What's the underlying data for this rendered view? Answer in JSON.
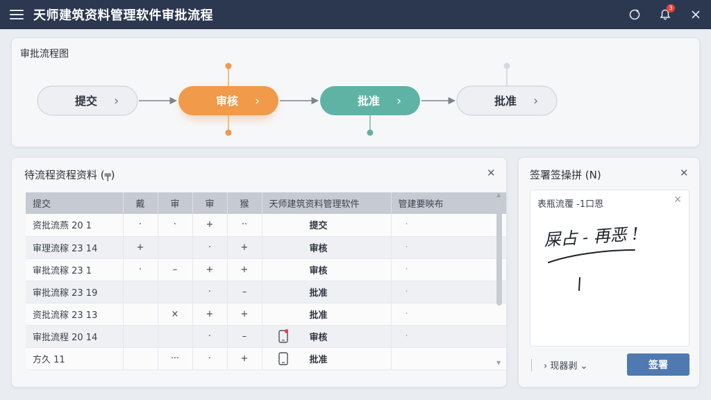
{
  "app": {
    "title": "天师建筑资料管理软件审批流程",
    "notification_count": "3",
    "icons": [
      "menu-icon",
      "refresh-icon",
      "bell-icon",
      "close-icon"
    ]
  },
  "flow": {
    "title": "审批流程图",
    "nodes": [
      {
        "label": "提交",
        "style": "outline",
        "color": "#eeeff2"
      },
      {
        "label": "审核",
        "style": "filled",
        "color": "#f09a4a"
      },
      {
        "label": "批准",
        "style": "filled",
        "color": "#5fb3a4"
      },
      {
        "label": "批准",
        "style": "outline",
        "color": "#eeeff2"
      }
    ],
    "arrow_glyph": "›"
  },
  "documents": {
    "title": "待流程资程资料 (╤)",
    "columns": [
      "提交",
      "戴",
      "审",
      "审",
      "猴",
      "天师建筑资料管理软件",
      "管建要映布"
    ],
    "rows": [
      {
        "name": "资批流燕 20 1",
        "c1": "·",
        "c2": "·",
        "c3": "+",
        "c4": "··",
        "icon": "",
        "stage": "提交",
        "last": "·"
      },
      {
        "name": "审理流稼 23 14",
        "c1": "+",
        "c2": "",
        "c3": "·",
        "c4": "+",
        "icon": "",
        "stage": "审核",
        "last": "·"
      },
      {
        "name": "审批流稼 23 1",
        "c1": "·",
        "c2": "–",
        "c3": "+",
        "c4": "+",
        "icon": "",
        "stage": "审核",
        "last": "·"
      },
      {
        "name": "审批流稼 23 19",
        "c1": "",
        "c2": "",
        "c3": "·",
        "c4": "–",
        "icon": "",
        "stage": "批准",
        "last": "·"
      },
      {
        "name": "资批流稼 23 13",
        "c1": "",
        "c2": "×",
        "c3": "+",
        "c4": "+",
        "icon": "",
        "stage": "批准",
        "last": "·"
      },
      {
        "name": "审批流程 20 14",
        "c1": "",
        "c2": "",
        "c3": "·",
        "c4": "–",
        "icon": "phone-alert-icon",
        "stage": "审核",
        "last": "·"
      },
      {
        "name": "方久           11",
        "c1": "",
        "c2": "···",
        "c3": "·",
        "c4": "+",
        "icon": "phone-icon",
        "stage": "批准",
        "last": ""
      }
    ]
  },
  "signature": {
    "title": "签署签操拼 (N)",
    "pad_label": "表瓶流覆 -1口恩",
    "handwriting": "屎占 - 再恶 !",
    "dropdown_label": "› 现器剥 ⌄",
    "sign_button": "签署"
  }
}
